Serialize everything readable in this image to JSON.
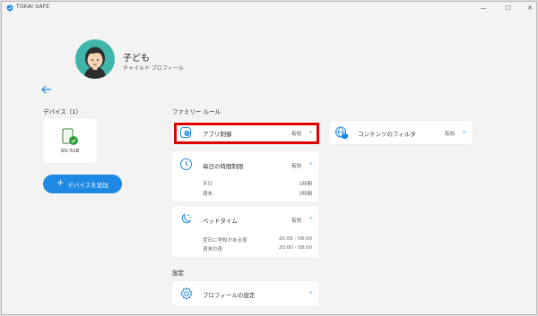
{
  "app": {
    "title": "TOKAI SAFE"
  },
  "window_controls": {
    "minimize": "—",
    "maximize": "☐",
    "close": "✕"
  },
  "profile": {
    "name": "子ども",
    "subtitle": "チャイルド プロフィール"
  },
  "devices": {
    "title": "デバイス（1）",
    "items": [
      {
        "name": "SO-51B"
      }
    ],
    "add_button": "デバイスを追加"
  },
  "family_rules": {
    "title": "ファミリー ルール",
    "app_restriction": {
      "label": "アプリ制御",
      "status": "有効"
    },
    "content_filter": {
      "label": "コンテンツのフィルタ",
      "status": "有効"
    },
    "time_limit": {
      "label": "毎日の時間制限",
      "status": "有効",
      "rows": [
        {
          "label": "平日",
          "value": "1時間"
        },
        {
          "label": "週末",
          "value": "2時間"
        }
      ]
    },
    "bedtime": {
      "label": "ベッドタイム",
      "status": "有効",
      "rows": [
        {
          "label": "翌日に学校がある夜",
          "value": "20:00 - 08:00"
        },
        {
          "label": "週末の夜",
          "value": "20:00 - 08:00"
        }
      ]
    }
  },
  "settings": {
    "title": "設定",
    "profile_settings": {
      "label": "プロフィールの設定"
    }
  },
  "colors": {
    "accent": "#1e88e5",
    "highlight": "#e00000",
    "avatar": "#3fb6a9"
  }
}
